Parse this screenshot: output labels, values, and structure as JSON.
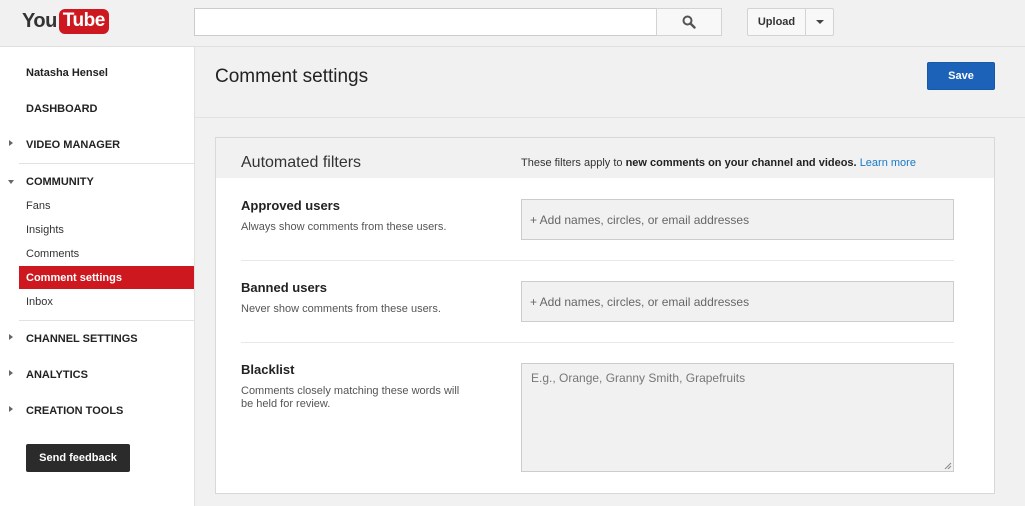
{
  "header": {
    "logo_you": "You",
    "logo_tube": "Tube",
    "search_placeholder": "",
    "upload_label": "Upload"
  },
  "sidebar": {
    "user_name": "Natasha Hensel",
    "sections": {
      "dashboard": "DASHBOARD",
      "video_manager": "VIDEO MANAGER",
      "community": "COMMUNITY",
      "channel_settings": "CHANNEL SETTINGS",
      "analytics": "ANALYTICS",
      "creation_tools": "CREATION TOOLS"
    },
    "community_items": [
      "Fans",
      "Insights",
      "Comments",
      "Comment settings",
      "Inbox"
    ],
    "active_item": "Comment settings",
    "feedback_label": "Send feedback"
  },
  "main": {
    "page_title": "Comment settings",
    "save_label": "Save",
    "panel": {
      "title": "Automated filters",
      "note_prefix": "These filters apply to ",
      "note_bold": "new comments on your channel and videos.",
      "learn_more": "Learn more",
      "approved": {
        "title": "Approved users",
        "desc": "Always show comments from these users.",
        "placeholder": "+ Add names, circles, or email addresses"
      },
      "banned": {
        "title": "Banned users",
        "desc": "Never show comments from these users.",
        "placeholder": "+ Add names, circles, or email addresses"
      },
      "blacklist": {
        "title": "Blacklist",
        "desc": "Comments closely matching these words will be held for review.",
        "placeholder": "E.g., Orange, Granny Smith, Grapefruits"
      }
    }
  },
  "colors": {
    "brand_red": "#cc181e",
    "save_blue": "#1c62b9",
    "link_blue": "#167ac6"
  },
  "icons": {
    "search": "search-icon",
    "dropdown": "chevron-down-icon"
  }
}
